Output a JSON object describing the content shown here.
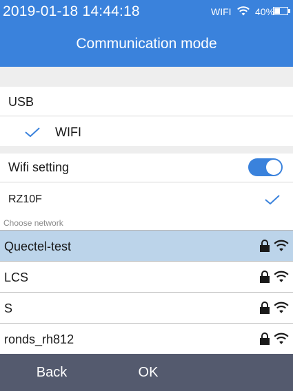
{
  "status_bar": {
    "datetime": "2019-01-18 14:44:18",
    "network": "WIFI",
    "battery_label": "40%",
    "battery_level": 0.4,
    "wifi_icon": "wifi-icon",
    "battery_icon": "battery-icon"
  },
  "header": {
    "title": "Communication mode"
  },
  "modes": [
    {
      "label": "USB",
      "selected": false
    },
    {
      "label": "WIFI",
      "selected": true
    }
  ],
  "wifi_setting": {
    "label": "Wifi setting",
    "enabled": true
  },
  "current_network": {
    "name": "RZ10F",
    "connected": true
  },
  "networks_section": {
    "label": "Choose network",
    "networks": [
      {
        "name": "Quectel-test",
        "selected": true,
        "locked": true
      },
      {
        "name": "LCS",
        "selected": false,
        "locked": true
      },
      {
        "name": "S",
        "selected": false,
        "locked": true
      },
      {
        "name": "ronds_rh812",
        "selected": false,
        "locked": true
      }
    ]
  },
  "footer": {
    "back_label": "Back",
    "ok_label": "OK"
  },
  "colors": {
    "accent": "#3a82dc",
    "selected_row": "#bcd4ea",
    "footer": "#545a6e",
    "check": "#3a82dc"
  }
}
